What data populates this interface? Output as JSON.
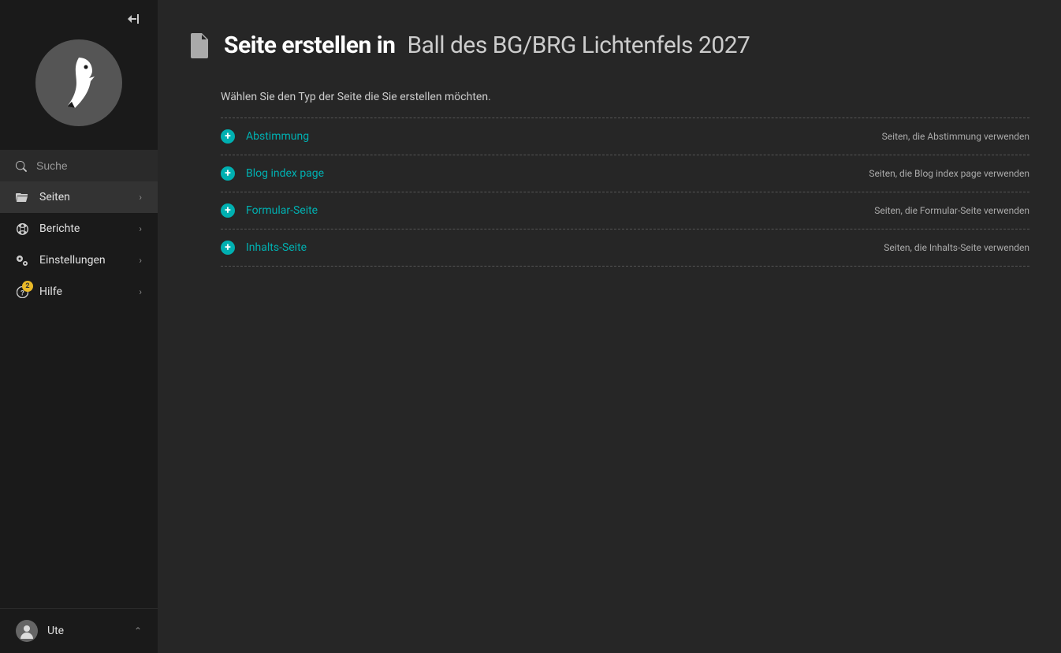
{
  "sidebar": {
    "search_placeholder": "Suche",
    "items": [
      {
        "label": "Seiten",
        "icon": "folder-open-icon",
        "active": true
      },
      {
        "label": "Berichte",
        "icon": "globe-icon",
        "active": false
      },
      {
        "label": "Einstellungen",
        "icon": "cogs-icon",
        "active": false
      },
      {
        "label": "Hilfe",
        "icon": "question-icon",
        "active": false,
        "badge": "2"
      }
    ],
    "user": {
      "name": "Ute"
    }
  },
  "header": {
    "title_prefix": "Seite erstellen in",
    "parent_title": "Ball des BG/BRG Lichtenfels 2027"
  },
  "helper": "Wählen Sie den Typ der Seite die Sie erstellen möchten.",
  "types": [
    {
      "name": "Abstimmung",
      "usage": "Seiten, die Abstimmung verwenden"
    },
    {
      "name": "Blog index page",
      "usage": "Seiten, die Blog index page verwenden"
    },
    {
      "name": "Formular-Seite",
      "usage": "Seiten, die Formular-Seite verwenden"
    },
    {
      "name": "Inhalts-Seite",
      "usage": "Seiten, die Inhalts-Seite verwenden"
    }
  ]
}
